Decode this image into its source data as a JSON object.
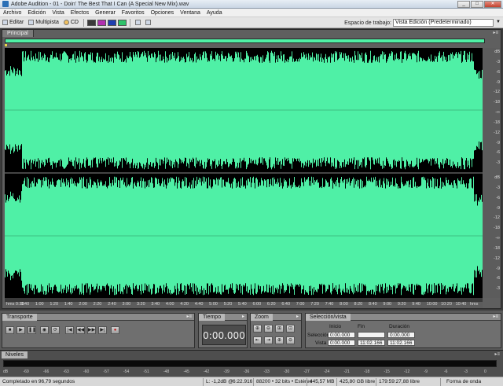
{
  "window": {
    "title": "Adobe Audition - 01 - Doin' The Best That I Can (A Special New Mix).wav",
    "buttons": {
      "minimize": "_",
      "maximize": "□",
      "close": "✕"
    }
  },
  "menu": [
    "Archivo",
    "Edición",
    "Vista",
    "Efectos",
    "Generar",
    "Favoritos",
    "Opciones",
    "Ventana",
    "Ayuda"
  ],
  "toolbar": {
    "edit_label": "Editar",
    "multitrack_label": "Multipista",
    "cd_label": "CD",
    "swatch_colors": [
      "#3a3a3a",
      "#b030b0",
      "#1f3fb0",
      "#2ec26a"
    ],
    "workspace_label": "Espacio de trabajo:",
    "workspace_value": "Vista Edición (Predeterminado)"
  },
  "main_panel": {
    "tab_label": "Principal",
    "waveform_color": "#4ff0a6",
    "db_ticks_top": [
      "dB",
      "-3",
      "-6",
      "-9",
      "-12",
      "-18",
      "-∞",
      "-18",
      "-12",
      "-9",
      "-6",
      "-3"
    ],
    "db_ticks_bottom": [
      "dB",
      "-3",
      "-6",
      "-9",
      "-12",
      "-18",
      "-∞",
      "-18",
      "-12",
      "-9",
      "-6",
      "-3"
    ],
    "time_labels": [
      "hms 0:20",
      "0:40",
      "1:00",
      "1:20",
      "1:40",
      "2:00",
      "2:20",
      "2:40",
      "3:00",
      "3:20",
      "3:40",
      "4:00",
      "4:20",
      "4:40",
      "5:00",
      "5:20",
      "5:40",
      "6:00",
      "6:20",
      "6:40",
      "7:00",
      "7:20",
      "7:40",
      "8:00",
      "8:20",
      "8:40",
      "9:00",
      "9:20",
      "9:40",
      "10:00",
      "10:20",
      "10:40",
      "hms"
    ]
  },
  "transport": {
    "tab_label": "Transporte",
    "buttons": [
      "stop",
      "play",
      "pause",
      "play-from-cursor",
      "loop",
      "go-to-start",
      "rewind",
      "fast-forward",
      "go-to-end",
      "record"
    ]
  },
  "time_panel": {
    "tab_label": "Tiempo",
    "value": "0:00.000"
  },
  "zoom_panel": {
    "tab_label": "Zoom"
  },
  "selection_panel": {
    "tab_label": "Selección/vista",
    "col_start": "Inicio",
    "col_end": "Fin",
    "col_duration": "Duración",
    "row_selection": "Selección",
    "row_view": "Vista",
    "selection_start": "0:00.000",
    "selection_end": "",
    "selection_duration": "0:00.000",
    "view_start": "0:00.000",
    "view_end": "11:02.166",
    "view_duration": "11:02.166"
  },
  "levels": {
    "tab_label": "Niveles",
    "scale": [
      "dB",
      "-69",
      "-66",
      "-63",
      "-60",
      "-57",
      "-54",
      "-51",
      "-48",
      "-45",
      "-42",
      "-39",
      "-36",
      "-33",
      "-30",
      "-27",
      "-24",
      "-21",
      "-18",
      "-15",
      "-12",
      "-9",
      "-6",
      "-3",
      "0"
    ]
  },
  "status": {
    "completed": "Completado en 96,79 segundos",
    "level": "L: -1,2dB @",
    "position": "6:22.916",
    "format": "88200 • 32 bits • Estéreo",
    "file_size": "445,57 MB",
    "free_space": "425,80 GB libre",
    "free_time": "179:59:27,88 libre",
    "view_mode": "Forma de onda"
  }
}
